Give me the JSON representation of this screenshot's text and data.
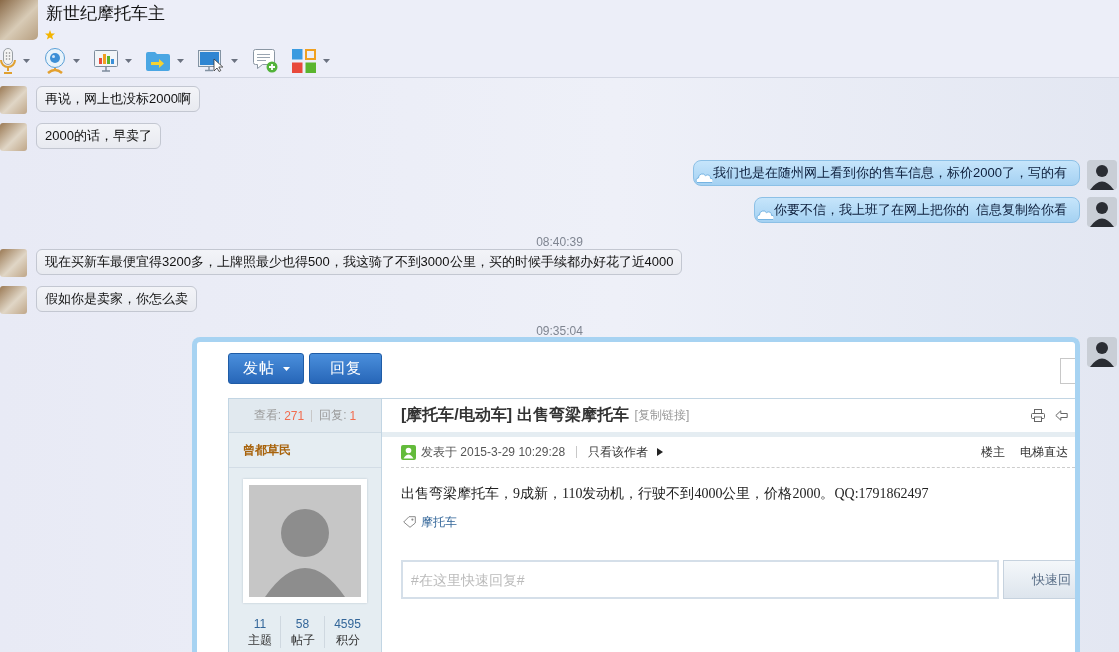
{
  "contact": {
    "name": "新世纪摩托车主"
  },
  "messages": [
    {
      "kind": "received",
      "text": "再说，网上也没标2000啊"
    },
    {
      "kind": "received",
      "text": "2000的话，早卖了"
    },
    {
      "kind": "sent",
      "text": "我们也是在随州网上看到你的售车信息，标价2000了，写的有"
    },
    {
      "kind": "sent",
      "text": "你要不信，我上班了在网上把你的  信息复制给你看"
    },
    {
      "kind": "time",
      "text": "08:40:39"
    },
    {
      "kind": "received",
      "text": "现在买新车最便宜得3200多，上牌照最少也得500，我这骑了不到3000公里，买的时候手续都办好花了近4000"
    },
    {
      "kind": "received",
      "text": "假如你是卖家，你怎么卖"
    },
    {
      "kind": "time",
      "text": "09:35:04"
    },
    {
      "kind": "sent_screenshot",
      "forum": {
        "buttons": [
          {
            "label": "发帖",
            "has_menu": true
          },
          {
            "label": "回复",
            "has_menu": false
          }
        ],
        "views_label": "查看:",
        "views": "271",
        "replies_label": "回复:",
        "replies": "1",
        "title": "[摩托车/电动车] 出售弯梁摩托车",
        "copy_link": "[复制链接]",
        "author": "曾都草民",
        "posted": "发表于 2015-3-29 10:29:28",
        "author_only": "只看该作者",
        "floor": "楼主",
        "jump": "电梯直达",
        "body": "出售弯梁摩托车，9成新，110发动机，行驶不到4000公里，价格2000。QQ:1791862497",
        "tag": "摩托车",
        "reply_placeholder": "#在这里快速回复#",
        "reply_button": "快速回",
        "author_stats": [
          {
            "value": "11",
            "label": "主题"
          },
          {
            "value": "58",
            "label": "帖子"
          },
          {
            "value": "4595",
            "label": "积分"
          }
        ]
      }
    }
  ]
}
